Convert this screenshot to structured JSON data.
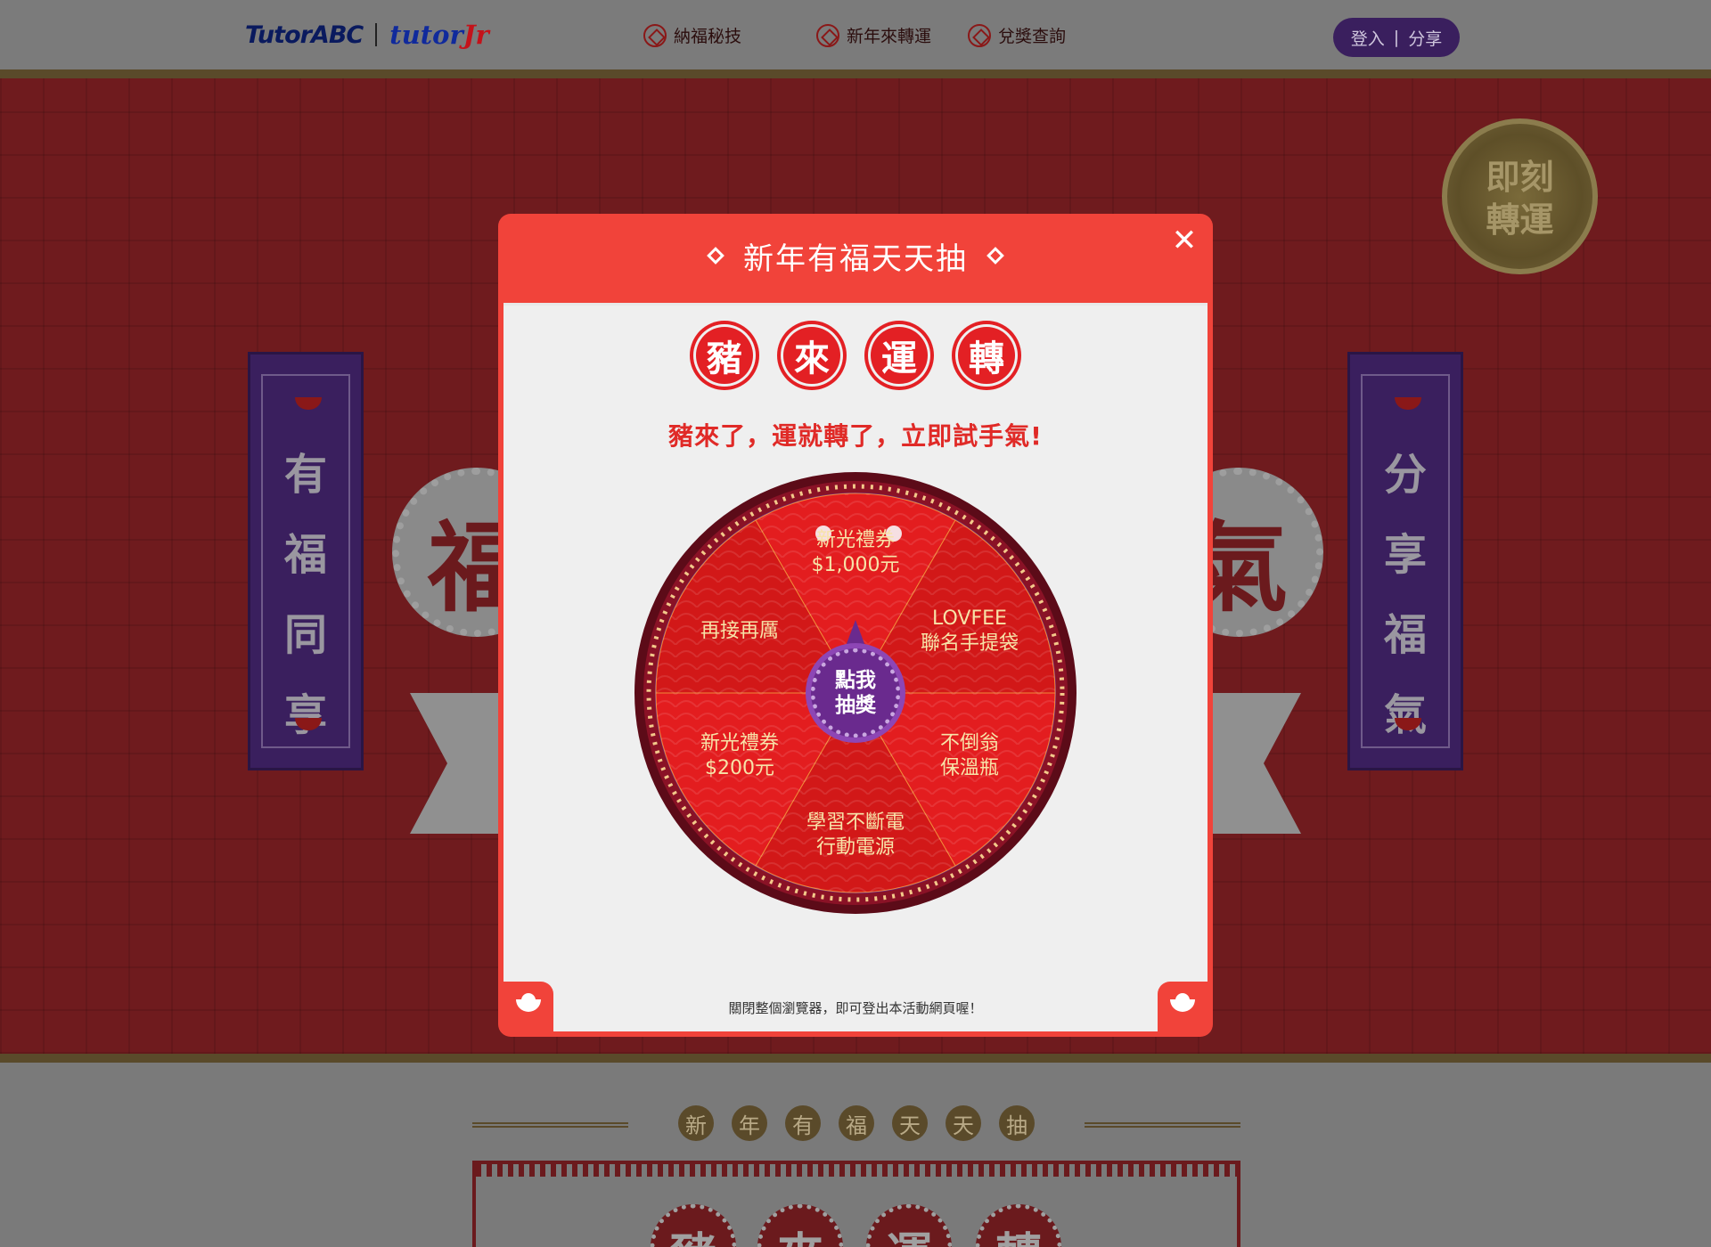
{
  "header": {
    "logo_primary": "TutorABC",
    "logo_secondary_a": "tutor",
    "logo_secondary_b": "Jr",
    "nav": [
      {
        "label": "納福秘技",
        "icon": "diamond-coin-icon"
      },
      {
        "label": "新年來轉運",
        "icon": "diamond-coin-icon"
      },
      {
        "label": "兌獎查詢",
        "icon": "diamond-coin-icon"
      }
    ],
    "login_label": "登入",
    "share_label": "分享",
    "login_separator": "|"
  },
  "hero": {
    "scroll_left": [
      "有",
      "福",
      "同",
      "享"
    ],
    "scroll_right": [
      "分",
      "享",
      "福",
      "氣"
    ],
    "medallion_left": "福",
    "medallion_right": "氣",
    "coin_badge": [
      "即刻",
      "轉運"
    ]
  },
  "modal": {
    "title": "新年有福天天抽",
    "close_label": "✕",
    "seals": [
      "豬",
      "來",
      "運",
      "轉"
    ],
    "slogan": "豬來了，運就轉了，立即試手氣!",
    "footer_note": "關閉整個瀏覽器，即可登出本活動網頁喔！",
    "wheel": {
      "spin_button": "點我抽獎",
      "prizes": [
        {
          "line1": "新光禮券",
          "line2": "$1,000元"
        },
        {
          "line1": "LOVFEE",
          "line2": "聯名手提袋"
        },
        {
          "line1": "不倒翁",
          "line2": "保溫瓶"
        },
        {
          "line1": "學習不斷電",
          "line2": "行動電源"
        },
        {
          "line1": "新光禮券",
          "line2": "$200元"
        },
        {
          "line1": "再接再厲",
          "line2": ""
        }
      ],
      "colors": {
        "segment_a": "#e31d1f",
        "segment_b": "#d21818",
        "rim": "#7a1020",
        "hub": "#6a2a8e",
        "text": "#f7e3a8"
      }
    }
  },
  "lower": {
    "title_chars": [
      "新",
      "年",
      "有",
      "福",
      "天",
      "天",
      "抽"
    ],
    "seals": [
      "豬",
      "來",
      "運",
      "轉"
    ]
  },
  "colors": {
    "brand_red": "#f1433a",
    "purple": "#6a2a8e",
    "overlay_gray": "#7a7a7a"
  }
}
